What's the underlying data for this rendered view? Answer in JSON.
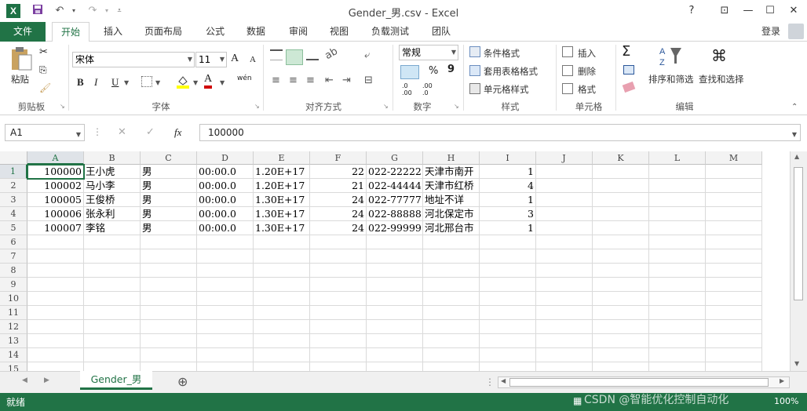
{
  "window": {
    "title": "Gender_男.csv - Excel",
    "controls": [
      "?",
      "⊡",
      "—",
      "☐",
      "✕"
    ]
  },
  "tabs": {
    "file": "文件",
    "items": [
      "开始",
      "插入",
      "页面布局",
      "公式",
      "数据",
      "审阅",
      "视图",
      "负载测试",
      "团队"
    ],
    "login": "登录"
  },
  "ribbon": {
    "clipboard": {
      "paste": "粘贴",
      "label": "剪贴板"
    },
    "font": {
      "name": "宋体",
      "size": "11",
      "label": "字体",
      "bold": "B",
      "italic": "I",
      "underline": "U",
      "grow": "A",
      "shrink": "A",
      "color": "A",
      "phonetic": "wén"
    },
    "alignment": {
      "label": "对齐方式"
    },
    "number": {
      "format": "常规",
      "label": "数字",
      "percent": "%",
      "comma": "9",
      "inc": ".0\n.00",
      "dec": ".00\n.0"
    },
    "styles": {
      "conditional": "条件格式",
      "table": "套用表格格式",
      "cell": "单元格样式",
      "label": "样式"
    },
    "cells": {
      "insert": "插入",
      "delete": "删除",
      "format": "格式",
      "label": "单元格"
    },
    "editing": {
      "sort": "排序和筛选",
      "find": "查找和选择",
      "label": "编辑"
    }
  },
  "formula_bar": {
    "name_box": "A1",
    "value": "100000",
    "fx": "fx",
    "cancel": "✕",
    "enter": "✓"
  },
  "grid": {
    "columns": [
      "A",
      "B",
      "C",
      "D",
      "E",
      "F",
      "G",
      "H",
      "I",
      "J",
      "K",
      "L",
      "M"
    ],
    "rows": [
      "1",
      "2",
      "3",
      "4",
      "5",
      "6",
      "7",
      "8",
      "9",
      "10",
      "11",
      "12",
      "13",
      "14",
      "15"
    ],
    "data": [
      [
        "100000",
        "王小虎",
        "男",
        "00:00.0",
        "1.20E+17",
        "22",
        "022-22222",
        "天津市南开",
        "1"
      ],
      [
        "100002",
        "马小李",
        "男",
        "00:00.0",
        "1.20E+17",
        "21",
        "022-44444",
        "天津市红桥",
        "4"
      ],
      [
        "100005",
        "王俊桥",
        "男",
        "00:00.0",
        "1.30E+17",
        "24",
        "022-77777",
        "地址不详",
        "1"
      ],
      [
        "100006",
        "张永利",
        "男",
        "00:00.0",
        "1.30E+17",
        "24",
        "022-88888",
        "河北保定市",
        "3"
      ],
      [
        "100007",
        "李铭",
        "男",
        "00:00.0",
        "1.30E+17",
        "24",
        "022-99999",
        "河北邢台市",
        "1"
      ]
    ]
  },
  "sheets": {
    "active": "Gender_男",
    "add": "⊕"
  },
  "status": {
    "ready": "就绪",
    "zoom": "100%",
    "watermark": "CSDN @智能优化控制自动化"
  },
  "colors": {
    "accent": "#217346",
    "selection": "#217346"
  }
}
